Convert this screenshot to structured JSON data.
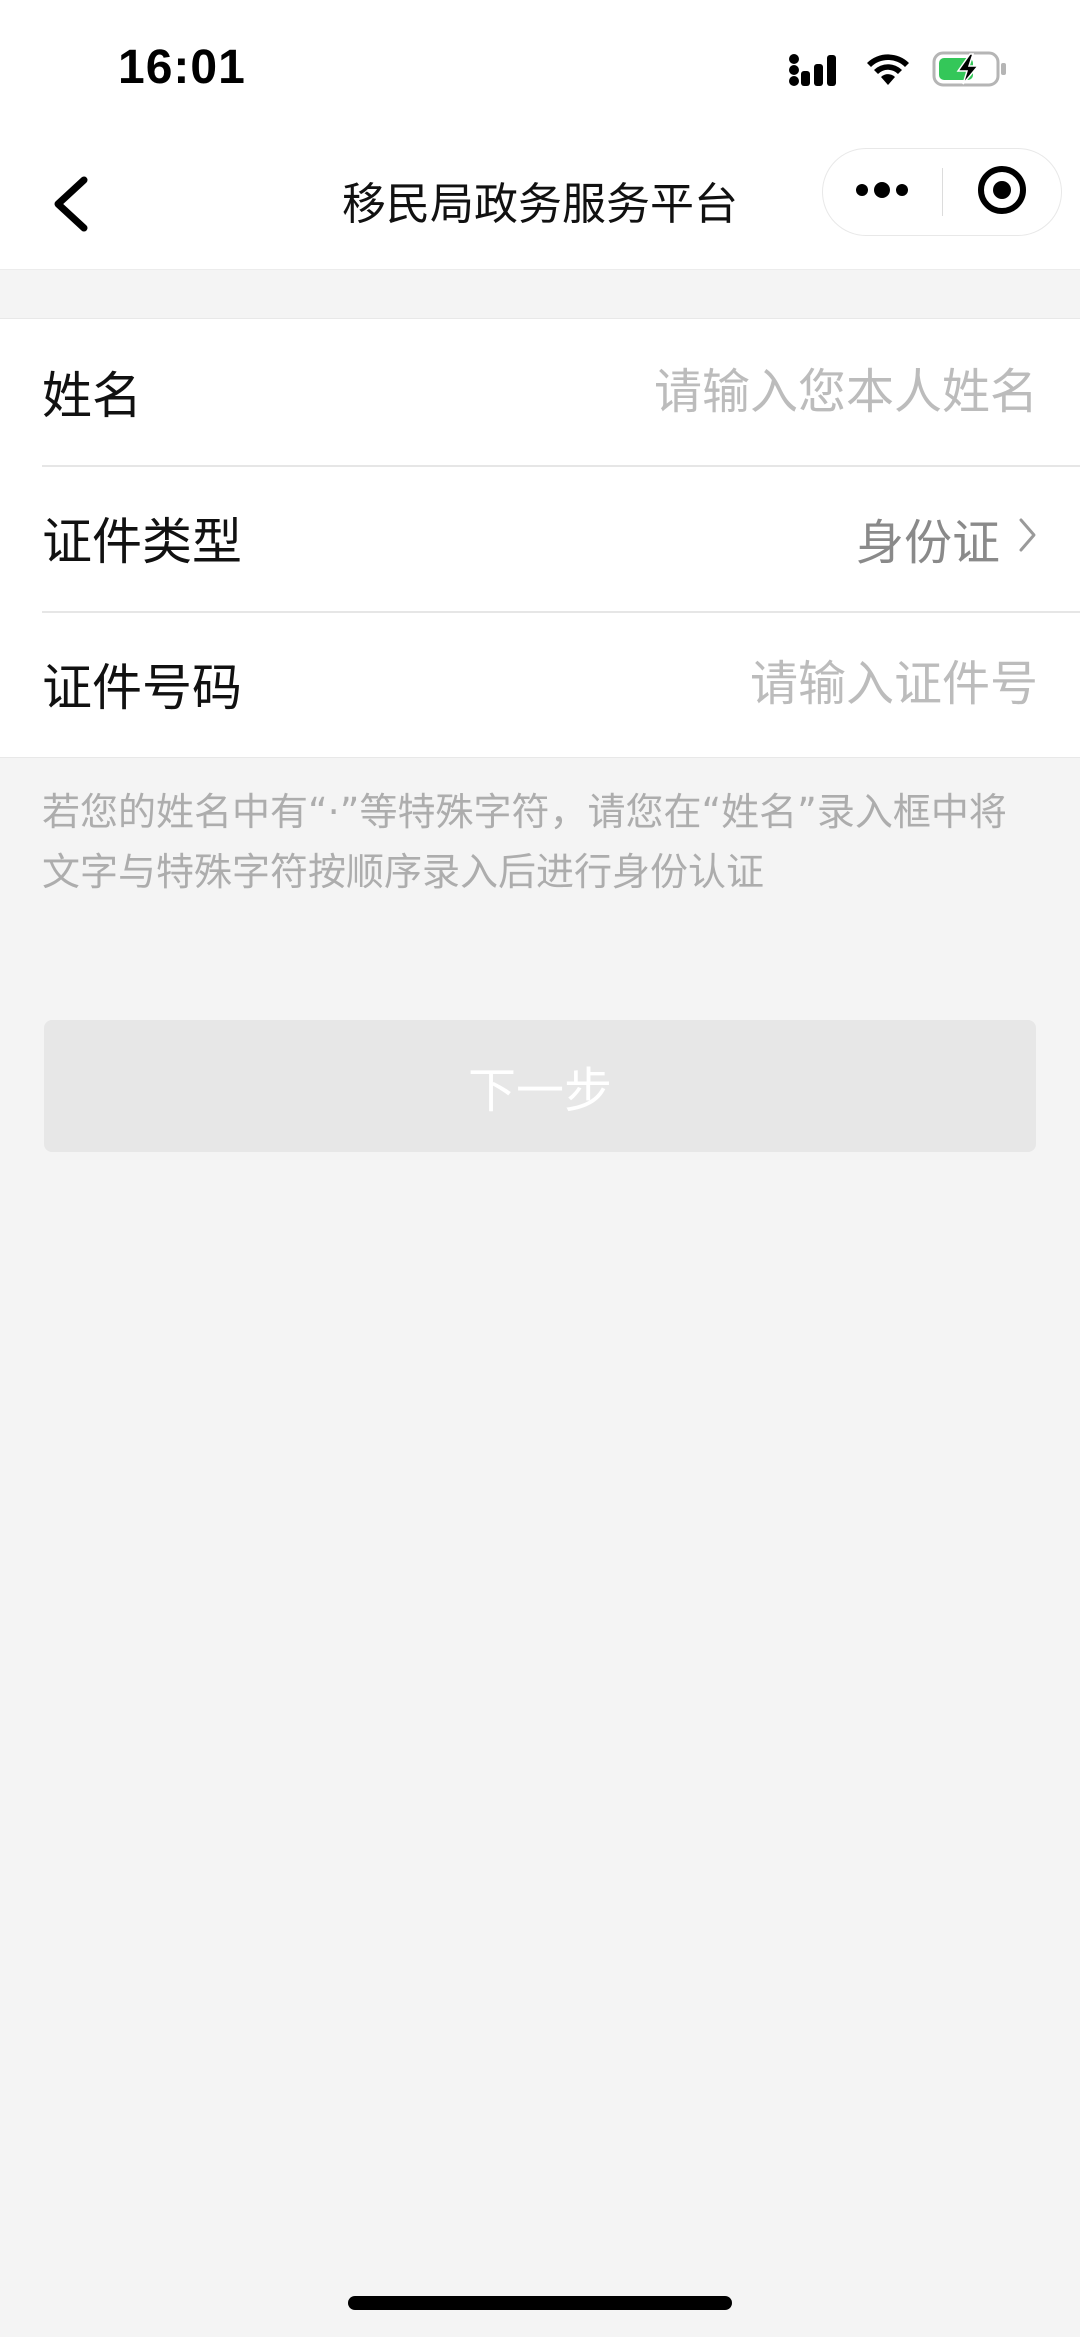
{
  "status_bar": {
    "time": "16:01",
    "icons": [
      "cellular-signal-icon",
      "wifi-icon",
      "battery-charging-icon"
    ],
    "battery_color": "#34c759"
  },
  "nav": {
    "title": "移民局政务服务平台",
    "back_icon": "chevron-left-icon",
    "more_icon": "more-dots-icon",
    "close_icon": "target-close-icon"
  },
  "form": {
    "name": {
      "label": "姓名",
      "placeholder": "请输入您本人姓名",
      "value": ""
    },
    "id_type": {
      "label": "证件类型",
      "value": "身份证",
      "icon": "chevron-right-icon"
    },
    "id_number": {
      "label": "证件号码",
      "placeholder": "请输入证件号",
      "value": ""
    }
  },
  "hint": "若您的姓名中有“·”等特殊字符，请您在“姓名”录入框中将文字与特殊字符按顺序录入后进行身份认证",
  "next_button": {
    "label": "下一步",
    "disabled": true
  },
  "colors": {
    "background": "#f4f4f4",
    "placeholder": "#bcbcbc",
    "button_disabled": "#e7e7e7"
  }
}
